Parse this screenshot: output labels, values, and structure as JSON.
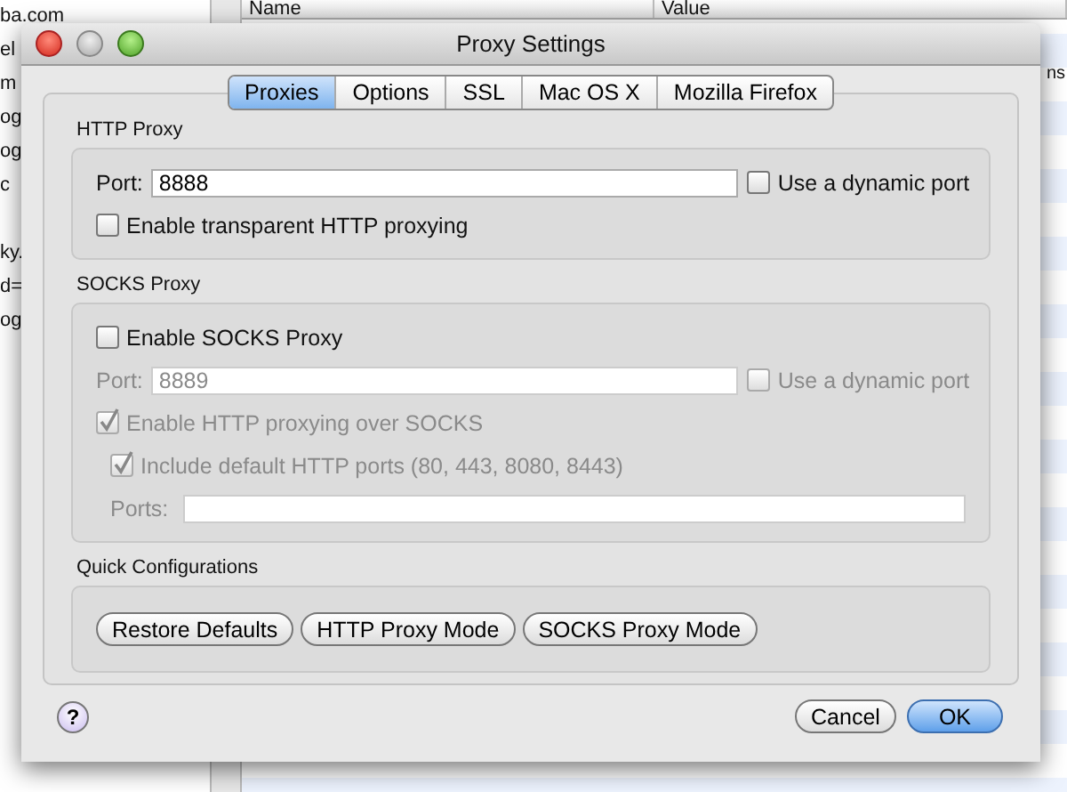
{
  "background_app": {
    "list_items": [
      "ba.com",
      "el",
      "m",
      "og",
      "og",
      "c",
      "ky.",
      "d=",
      "og"
    ],
    "columns": [
      "Name",
      "Value"
    ],
    "side_text": "ns"
  },
  "window": {
    "title": "Proxy Settings"
  },
  "tabs": [
    {
      "label": "Proxies",
      "selected": true
    },
    {
      "label": "Options",
      "selected": false
    },
    {
      "label": "SSL",
      "selected": false
    },
    {
      "label": "Mac OS X",
      "selected": false
    },
    {
      "label": "Mozilla Firefox",
      "selected": false
    }
  ],
  "http_proxy": {
    "title": "HTTP Proxy",
    "port_label": "Port:",
    "port_value": "8888",
    "disabled": false,
    "dynamic_port": {
      "label": "Use a dynamic port",
      "checked": false,
      "disabled": false
    },
    "transparent": {
      "label": "Enable transparent HTTP proxying",
      "checked": false,
      "disabled": false
    }
  },
  "socks_proxy": {
    "title": "SOCKS Proxy",
    "enable": {
      "label": "Enable SOCKS Proxy",
      "checked": false,
      "disabled": false
    },
    "port_label": "Port:",
    "port_value": "8889",
    "disabled": true,
    "dynamic_port": {
      "label": "Use a dynamic port",
      "checked": false,
      "disabled": true
    },
    "over_socks": {
      "label": "Enable HTTP proxying over SOCKS",
      "checked": true,
      "disabled": true
    },
    "include_default": {
      "label": "Include default HTTP ports (80, 443, 8080, 8443)",
      "checked": true,
      "disabled": true
    },
    "ports_label": "Ports:"
  },
  "quick_configurations": {
    "title": "Quick Configurations",
    "buttons": [
      "Restore Defaults",
      "HTTP Proxy Mode",
      "SOCKS Proxy Mode"
    ]
  },
  "footer": {
    "help": "?",
    "buttons": [
      {
        "label": "Cancel",
        "default": false
      },
      {
        "label": "OK",
        "default": true
      }
    ]
  }
}
